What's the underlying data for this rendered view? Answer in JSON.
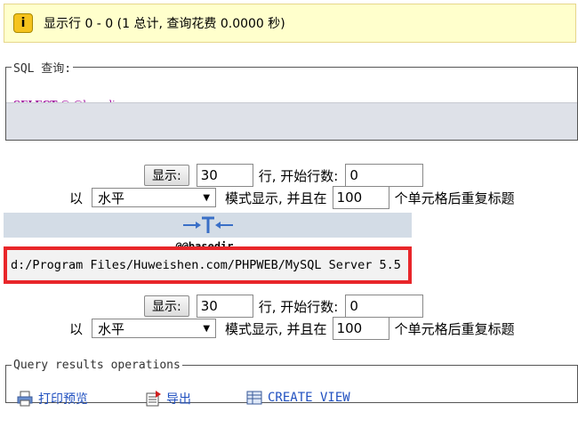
{
  "notice": {
    "text": "显示行 0 - 0 (1 总计, 查询花费 0.0000 秒)"
  },
  "sql": {
    "legend": "SQL 查询:",
    "keyword": "SELECT",
    "at": "@",
    "variable": "@basedir"
  },
  "controls": {
    "show_button": "显示:",
    "rows_value": "30",
    "start_label": "行, 开始行数:",
    "start_value": "0",
    "prefix": "以",
    "mode_value": "水平",
    "mode_suffix": "模式显示, 并且在",
    "repeat_value": "100",
    "repeat_suffix": "个单元格后重复标题"
  },
  "results": {
    "column": "@@basedir",
    "rows": [
      "d:/Program Files/Huweishen.com/PHPWEB/MySQL Server 5.5"
    ]
  },
  "operations": {
    "legend": "Query results operations",
    "print": "打印预览",
    "export": "导出",
    "create_view": "CREATE VIEW"
  }
}
